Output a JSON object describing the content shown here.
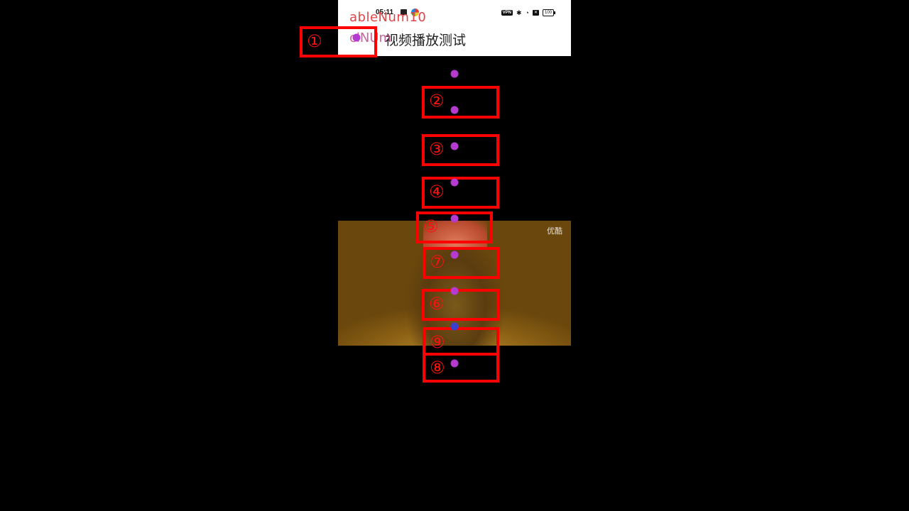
{
  "status_bar": {
    "time": "05:11",
    "vpn": "VPN",
    "battery": "100",
    "icons": [
      "message-icon",
      "app-icon",
      "vpn-icon",
      "bluetooth-icon",
      "wifi-icon",
      "sim-x-icon",
      "battery-icon"
    ]
  },
  "app_bar": {
    "title": "视频播放测试"
  },
  "video": {
    "watermark": "优酷"
  },
  "overlay": {
    "title": "ableNum10",
    "subtitle": "clNUm",
    "box_numbers": [
      "①",
      "②",
      "③",
      "④",
      "⑤",
      "⑦",
      "⑥",
      "⑨",
      "⑧"
    ],
    "colors": {
      "box": "#ff0000",
      "dot": "#b53ad0",
      "dot_alt": "#3b3fd0"
    }
  }
}
